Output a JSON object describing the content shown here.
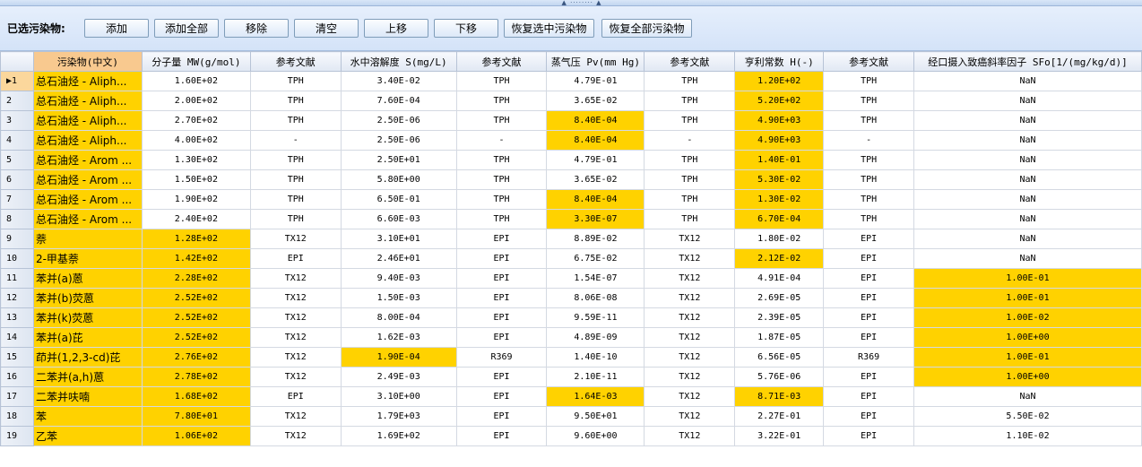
{
  "splitter_grip": "▲ ········ ▲",
  "toolbar": {
    "label": "已选污染物:",
    "buttons": [
      "添加",
      "添加全部",
      "移除",
      "清空",
      "上移",
      "下移",
      "恢复选中污染物",
      "恢复全部污染物"
    ]
  },
  "columns": [
    "",
    "污染物(中文)",
    "分子量 MW(g/mol)",
    "参考文献",
    "水中溶解度 S(mg/L)",
    "参考文献",
    "蒸气压 Pv(mm Hg)",
    "参考文献",
    "亨利常数 H(-)",
    "参考文献",
    "经口摄入致癌斜率因子 SFo[1/(mg/kg/d)]"
  ],
  "current_row_marker": "▶1",
  "rows": [
    {
      "n": "1",
      "name": "总石油烃 - Aliph...",
      "mw": "1.60E+02",
      "r1": "TPH",
      "s": "3.40E-02",
      "r2": "TPH",
      "pv": "4.79E-01",
      "r3": "TPH",
      "h": "1.20E+02",
      "r4": "TPH",
      "sf": "NaN"
    },
    {
      "n": "2",
      "name": "总石油烃 - Aliph...",
      "mw": "2.00E+02",
      "r1": "TPH",
      "s": "7.60E-04",
      "r2": "TPH",
      "pv": "3.65E-02",
      "r3": "TPH",
      "h": "5.20E+02",
      "r4": "TPH",
      "sf": "NaN"
    },
    {
      "n": "3",
      "name": "总石油烃 - Aliph...",
      "mw": "2.70E+02",
      "r1": "TPH",
      "s": "2.50E-06",
      "r2": "TPH",
      "pv": "8.40E-04",
      "r3": "TPH",
      "h": "4.90E+03",
      "r4": "TPH",
      "sf": "NaN"
    },
    {
      "n": "4",
      "name": "总石油烃 - Aliph...",
      "mw": "4.00E+02",
      "r1": "-",
      "s": "2.50E-06",
      "r2": "-",
      "pv": "8.40E-04",
      "r3": "-",
      "h": "4.90E+03",
      "r4": "-",
      "sf": "NaN"
    },
    {
      "n": "5",
      "name": "总石油烃 - Arom ...",
      "mw": "1.30E+02",
      "r1": "TPH",
      "s": "2.50E+01",
      "r2": "TPH",
      "pv": "4.79E-01",
      "r3": "TPH",
      "h": "1.40E-01",
      "r4": "TPH",
      "sf": "NaN"
    },
    {
      "n": "6",
      "name": "总石油烃 - Arom ...",
      "mw": "1.50E+02",
      "r1": "TPH",
      "s": "5.80E+00",
      "r2": "TPH",
      "pv": "3.65E-02",
      "r3": "TPH",
      "h": "5.30E-02",
      "r4": "TPH",
      "sf": "NaN"
    },
    {
      "n": "7",
      "name": "总石油烃 - Arom ...",
      "mw": "1.90E+02",
      "r1": "TPH",
      "s": "6.50E-01",
      "r2": "TPH",
      "pv": "8.40E-04",
      "r3": "TPH",
      "h": "1.30E-02",
      "r4": "TPH",
      "sf": "NaN"
    },
    {
      "n": "8",
      "name": "总石油烃 - Arom ...",
      "mw": "2.40E+02",
      "r1": "TPH",
      "s": "6.60E-03",
      "r2": "TPH",
      "pv": "3.30E-07",
      "r3": "TPH",
      "h": "6.70E-04",
      "r4": "TPH",
      "sf": "NaN"
    },
    {
      "n": "9",
      "name": "萘",
      "mw": "1.28E+02",
      "r1": "TX12",
      "s": "3.10E+01",
      "r2": "EPI",
      "pv": "8.89E-02",
      "r3": "TX12",
      "h": "1.80E-02",
      "r4": "EPI",
      "sf": "NaN"
    },
    {
      "n": "10",
      "name": "2-甲基萘",
      "mw": "1.42E+02",
      "r1": "EPI",
      "s": "2.46E+01",
      "r2": "EPI",
      "pv": "6.75E-02",
      "r3": "TX12",
      "h": "2.12E-02",
      "r4": "EPI",
      "sf": "NaN"
    },
    {
      "n": "11",
      "name": "苯并(a)蒽",
      "mw": "2.28E+02",
      "r1": "TX12",
      "s": "9.40E-03",
      "r2": "EPI",
      "pv": "1.54E-07",
      "r3": "TX12",
      "h": "4.91E-04",
      "r4": "EPI",
      "sf": "1.00E-01"
    },
    {
      "n": "12",
      "name": "苯并(b)荧蒽",
      "mw": "2.52E+02",
      "r1": "TX12",
      "s": "1.50E-03",
      "r2": "EPI",
      "pv": "8.06E-08",
      "r3": "TX12",
      "h": "2.69E-05",
      "r4": "EPI",
      "sf": "1.00E-01"
    },
    {
      "n": "13",
      "name": "苯并(k)荧蒽",
      "mw": "2.52E+02",
      "r1": "TX12",
      "s": "8.00E-04",
      "r2": "EPI",
      "pv": "9.59E-11",
      "r3": "TX12",
      "h": "2.39E-05",
      "r4": "EPI",
      "sf": "1.00E-02"
    },
    {
      "n": "14",
      "name": "苯并(a)芘",
      "mw": "2.52E+02",
      "r1": "TX12",
      "s": "1.62E-03",
      "r2": "EPI",
      "pv": "4.89E-09",
      "r3": "TX12",
      "h": "1.87E-05",
      "r4": "EPI",
      "sf": "1.00E+00"
    },
    {
      "n": "15",
      "name": "茚并(1,2,3-cd)芘",
      "mw": "2.76E+02",
      "r1": "TX12",
      "s": "1.90E-04",
      "r2": "R369",
      "pv": "1.40E-10",
      "r3": "TX12",
      "h": "6.56E-05",
      "r4": "R369",
      "sf": "1.00E-01"
    },
    {
      "n": "16",
      "name": "二苯并(a,h)蒽",
      "mw": "2.78E+02",
      "r1": "TX12",
      "s": "2.49E-03",
      "r2": "EPI",
      "pv": "2.10E-11",
      "r3": "TX12",
      "h": "5.76E-06",
      "r4": "EPI",
      "sf": "1.00E+00"
    },
    {
      "n": "17",
      "name": "二苯并呋喃",
      "mw": "1.68E+02",
      "r1": "EPI",
      "s": "3.10E+00",
      "r2": "EPI",
      "pv": "1.64E-03",
      "r3": "TX12",
      "h": "8.71E-03",
      "r4": "EPI",
      "sf": "NaN"
    },
    {
      "n": "18",
      "name": "苯",
      "mw": "7.80E+01",
      "r1": "TX12",
      "s": "1.79E+03",
      "r2": "EPI",
      "pv": "9.50E+01",
      "r3": "TX12",
      "h": "2.27E-01",
      "r4": "EPI",
      "sf": "5.50E-02"
    },
    {
      "n": "19",
      "name": "乙苯",
      "mw": "1.06E+02",
      "r1": "TX12",
      "s": "1.69E+02",
      "r2": "EPI",
      "pv": "9.60E+00",
      "r3": "TX12",
      "h": "3.22E-01",
      "r4": "EPI",
      "sf": "1.10E-02"
    }
  ],
  "highlight_color": "#ffd200"
}
